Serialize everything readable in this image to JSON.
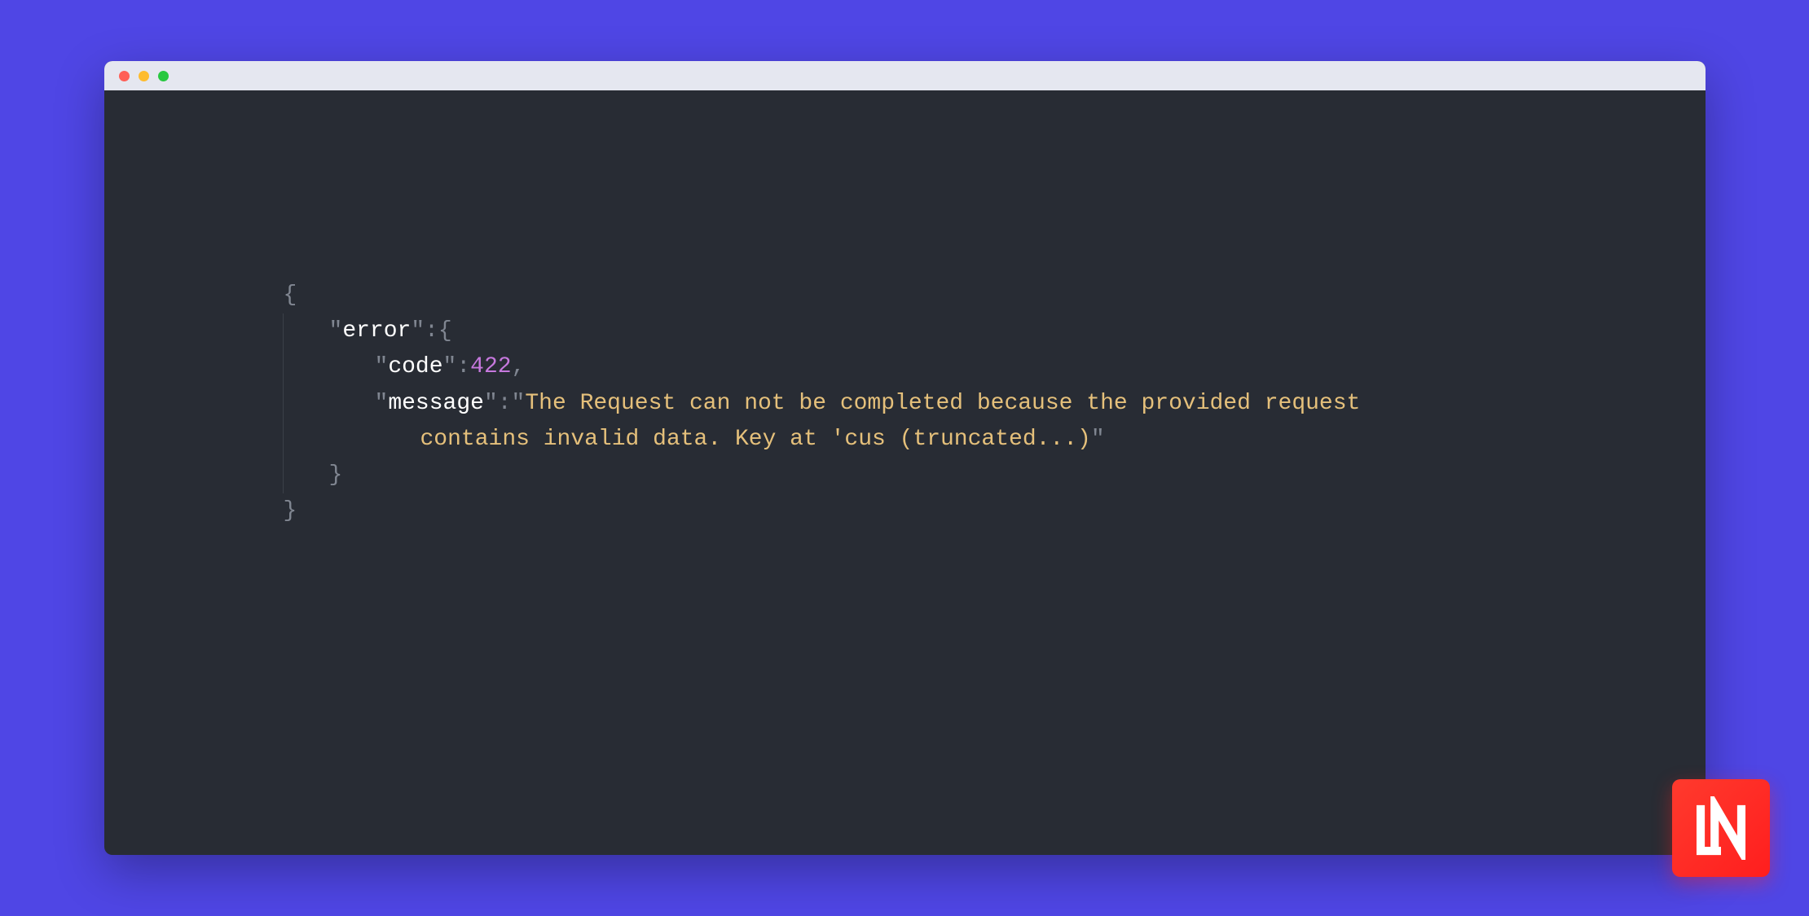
{
  "code": {
    "lines": [
      {
        "indent": 0,
        "tokens": [
          {
            "cls": "tok-punc",
            "text": "{"
          }
        ]
      },
      {
        "indent": 1,
        "guide": true,
        "tokens": [
          {
            "cls": "tok-punc",
            "text": "\""
          },
          {
            "cls": "tok-key",
            "text": "error"
          },
          {
            "cls": "tok-punc",
            "text": "\":{"
          }
        ]
      },
      {
        "indent": 2,
        "guide": true,
        "tokens": [
          {
            "cls": "tok-punc",
            "text": "\""
          },
          {
            "cls": "tok-key",
            "text": "code"
          },
          {
            "cls": "tok-punc",
            "text": "\":"
          },
          {
            "cls": "tok-num",
            "text": "422"
          },
          {
            "cls": "tok-punc",
            "text": ","
          }
        ]
      },
      {
        "indent": 2,
        "guide": true,
        "tokens": [
          {
            "cls": "tok-punc",
            "text": "\""
          },
          {
            "cls": "tok-key",
            "text": "message"
          },
          {
            "cls": "tok-punc",
            "text": "\":\""
          },
          {
            "cls": "tok-str",
            "text": "The Request can not be completed because the provided request"
          }
        ]
      },
      {
        "indent": 3,
        "guide": true,
        "tokens": [
          {
            "cls": "tok-str",
            "text": "contains invalid data. Key at 'cus (truncated...)"
          },
          {
            "cls": "tok-punc",
            "text": "\""
          }
        ]
      },
      {
        "indent": 1,
        "guide": true,
        "tokens": [
          {
            "cls": "tok-punc",
            "text": "}"
          }
        ]
      },
      {
        "indent": 0,
        "tokens": [
          {
            "cls": "tok-punc",
            "text": "}"
          }
        ]
      }
    ]
  },
  "logo": {
    "text": "LN"
  },
  "colors": {
    "background": "#4f46e5",
    "editor": "#282c34",
    "titlebar": "#e5e7f0",
    "punctuation": "#808691",
    "key": "#ffffff",
    "number": "#c678dd",
    "string": "#e5c07b",
    "logo": "#ff1e1e"
  }
}
